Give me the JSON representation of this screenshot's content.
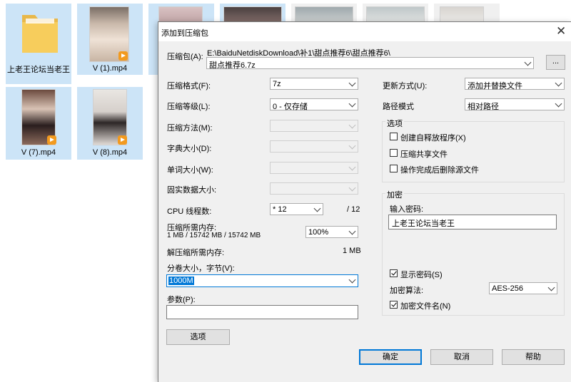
{
  "explorer": {
    "files": [
      {
        "name": "上老王论坛当老王",
        "type": "folder"
      },
      {
        "name": "V (1).mp4",
        "type": "video"
      },
      {
        "name": "V (7).mp4",
        "type": "video"
      },
      {
        "name": "V (8).mp4",
        "type": "video"
      }
    ]
  },
  "dialog": {
    "title": "添加到压缩包",
    "archive_label": "压缩包(A):",
    "archive_path": "E:\\BaiduNetdiskDownload\\补1\\甜点推荐6\\甜点推荐6\\",
    "archive_name": "甜点推荐6.7z",
    "browse_label": "...",
    "left": {
      "format_label": "压缩格式(F):",
      "format_value": "7z",
      "level_label": "压缩等级(L):",
      "level_value": "0 - 仅存储",
      "method_label": "压缩方法(M):",
      "dict_label": "字典大小(D):",
      "word_label": "单词大小(W):",
      "solid_label": "固实数据大小:",
      "cpu_label": "CPU 线程数:",
      "cpu_value": "* 12",
      "cpu_total": "/ 12",
      "mem_label": "压缩所需内存:",
      "mem_detail": "1 MB / 15742 MB / 15742 MB",
      "mem_percent": "100%",
      "decomp_label": "解压缩所需内存:",
      "decomp_value": "1 MB",
      "volume_label": "分卷大小，字节(V):",
      "volume_value": "1000M",
      "params_label": "参数(P):",
      "params_value": "",
      "options_button": "选项"
    },
    "right": {
      "update_label": "更新方式(U):",
      "update_value": "添加并替换文件",
      "path_label": "路径模式",
      "path_value": "相对路径",
      "options_group": "选项",
      "opt_sfx": "创建自释放程序(X)",
      "opt_shared": "压缩共享文件",
      "opt_delete": "操作完成后删除源文件",
      "encrypt_group": "加密",
      "password_label": "输入密码:",
      "password_value": "上老王论坛当老王",
      "show_password": "显示密码(S)",
      "enc_method_label": "加密算法:",
      "enc_method_value": "AES-256",
      "encrypt_names": "加密文件名(N)"
    },
    "buttons": {
      "ok": "确定",
      "cancel": "取消",
      "help": "帮助"
    }
  }
}
